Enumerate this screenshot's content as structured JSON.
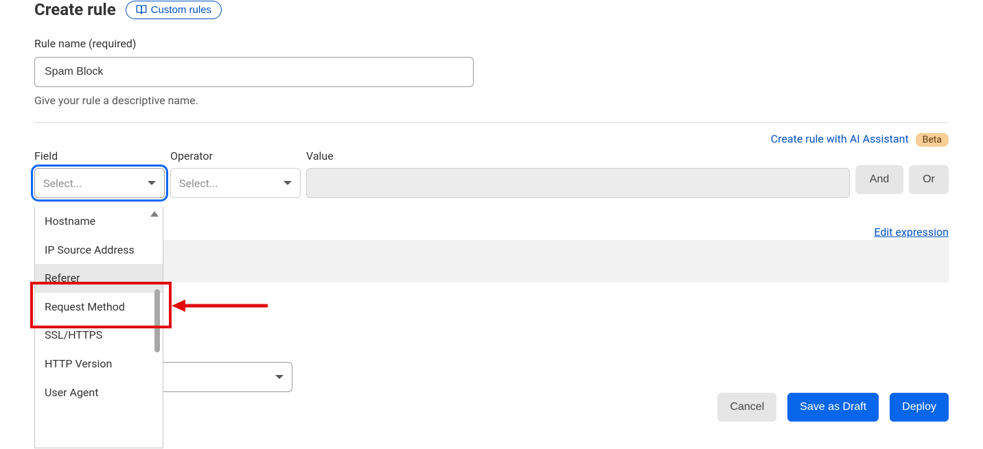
{
  "header": {
    "title": "Create rule",
    "custom_rules": "Custom rules"
  },
  "rule_name": {
    "label": "Rule name (required)",
    "value": "Spam Block",
    "helper": "Give your rule a descriptive name."
  },
  "ai": {
    "link": "Create rule with AI Assistant",
    "badge": "Beta"
  },
  "expr": {
    "field_label": "Field",
    "operator_label": "Operator",
    "value_label": "Value",
    "select_placeholder": "Select...",
    "and": "And",
    "or": "Or",
    "edit_expression": "Edit expression"
  },
  "dropdown": {
    "items": [
      "Hostname",
      "IP Source Address",
      "Referer",
      "Request Method",
      "SSL/HTTPS",
      "HTTP Version",
      "User Agent"
    ],
    "highlight_index": 2
  },
  "footer": {
    "cancel": "Cancel",
    "save_draft": "Save as Draft",
    "deploy": "Deploy"
  }
}
